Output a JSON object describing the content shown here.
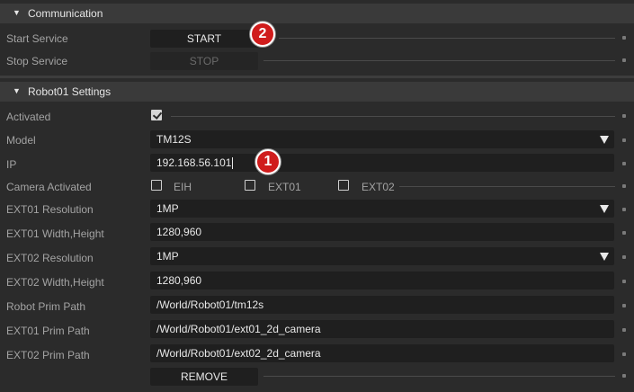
{
  "communication": {
    "title": "Communication",
    "start_label": "Start Service",
    "start_button": "START",
    "stop_label": "Stop Service",
    "stop_button": "STOP"
  },
  "robot": {
    "title": "Robot01 Settings",
    "activated_label": "Activated",
    "activated": true,
    "model_label": "Model",
    "model_value": "TM12S",
    "ip_label": "IP",
    "ip_value": "192.168.56.101",
    "camera_label": "Camera Activated",
    "camera_options": [
      "EIH",
      "EXT01",
      "EXT02"
    ],
    "ext01_res_label": "EXT01 Resolution",
    "ext01_res_value": "1MP",
    "ext01_wh_label": "EXT01 Width,Height",
    "ext01_wh_value": "1280,960",
    "ext02_res_label": "EXT02 Resolution",
    "ext02_res_value": "1MP",
    "ext02_wh_label": "EXT02 Width,Height",
    "ext02_wh_value": "1280,960",
    "robot_prim_label": "Robot Prim Path",
    "robot_prim_value": "/World/Robot01/tm12s",
    "ext01_prim_label": "EXT01 Prim Path",
    "ext01_prim_value": "/World/Robot01/ext01_2d_camera",
    "ext02_prim_label": "EXT02 Prim Path",
    "ext02_prim_value": "/World/Robot01/ext02_2d_camera",
    "remove_button": "REMOVE"
  },
  "annotations": {
    "badge1": "1",
    "badge2": "2"
  },
  "colors": {
    "badge": "#d01c1c",
    "background": "#2b2b2b",
    "field": "#1f1f1f"
  },
  "icons": [
    "collapse-triangle-icon",
    "dropdown-arrow-icon",
    "checkbox-icon"
  ]
}
